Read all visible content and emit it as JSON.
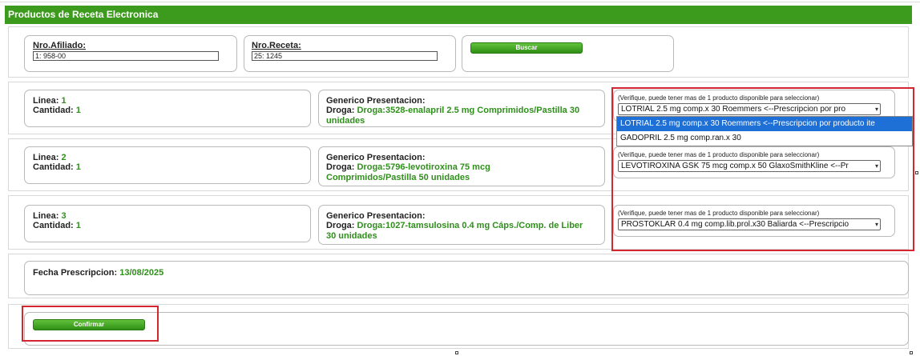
{
  "title": "Productos de Receta Electronica",
  "search": {
    "afiliado_label": "Nro.Afiliado:",
    "afiliado_value": "1:   958-00",
    "receta_label": "Nro.Receta:",
    "receta_value": "25:          1245",
    "buscar_label": "Buscar"
  },
  "labels": {
    "linea": "Linea:",
    "cantidad": "Cantidad:",
    "generico": "Generico Presentacion:",
    "droga": "Droga:",
    "verify_hint": "(Verifique, puede tener mas de 1 producto disponible para seleccionar)"
  },
  "items": [
    {
      "linea": "1",
      "cantidad": "1",
      "droga": "Droga:3528-enalapril 2.5 mg Comprimidos/Pastilla 30 unidades",
      "selected": "LOTRIAL 2.5 mg comp.x 30 Roemmers <--Prescripcion por pro",
      "options": [
        "LOTRIAL 2.5 mg comp.x 30 Roemmers <--Prescripcion por producto ite",
        "GADOPRIL 2.5 mg comp.ran.x 30"
      ]
    },
    {
      "linea": "2",
      "cantidad": "1",
      "droga": "Droga:5796-levotiroxina 75 mcg Comprimidos/Pastilla 50 unidades",
      "selected": "LEVOTIROXINA GSK 75 mcg comp.x 50 GlaxoSmithKline <--Pr"
    },
    {
      "linea": "3",
      "cantidad": "1",
      "droga": "Droga:1027-tamsulosina 0.4 mg Cáps./Comp. de Liber 30 unidades",
      "selected": "PROSTOKLAR 0.4 mg comp.lib.prol.x30 Baliarda <--Prescripcio"
    }
  ],
  "fecha": {
    "label": "Fecha Prescripcion:",
    "value": "13/08/2025"
  },
  "confirmar_label": "Confirmar",
  "colors": {
    "header_green": "#3c9a1c",
    "value_green": "#2f8f1b",
    "highlight_red": "#d4262e",
    "selected_blue": "#1e70d6"
  }
}
